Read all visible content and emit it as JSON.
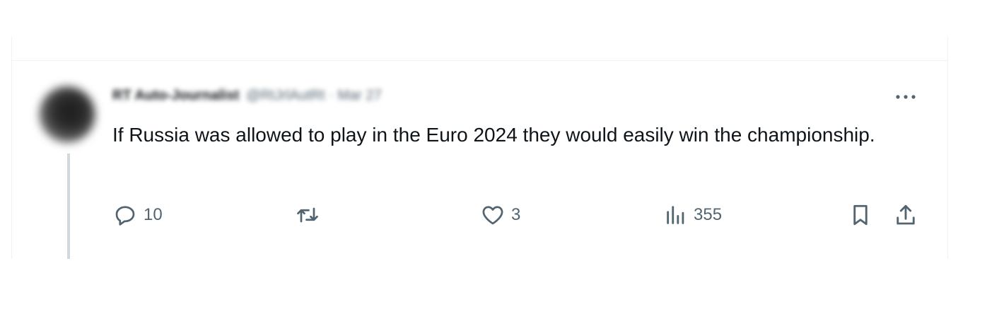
{
  "tweet": {
    "display_name": "RT Auto-Journalist",
    "handle_meta": "@RtJrlAutRt · Mar 27",
    "text": "If Russia was allowed to play in the Euro 2024 they would easily win the championship.",
    "more_icon": "more-horizontal-icon"
  },
  "actions": {
    "reply": {
      "icon": "reply-icon",
      "count": "10"
    },
    "retweet": {
      "icon": "retweet-icon",
      "count": ""
    },
    "like": {
      "icon": "heart-icon",
      "count": "3"
    },
    "views": {
      "icon": "views-bar-chart-icon",
      "count": "355"
    },
    "bookmark": {
      "icon": "bookmark-icon"
    },
    "share": {
      "icon": "share-icon"
    }
  },
  "colors": {
    "text_primary": "#0f1419",
    "text_secondary": "#536471",
    "divider": "#eff3f4",
    "thread_line": "#cfd9de"
  }
}
